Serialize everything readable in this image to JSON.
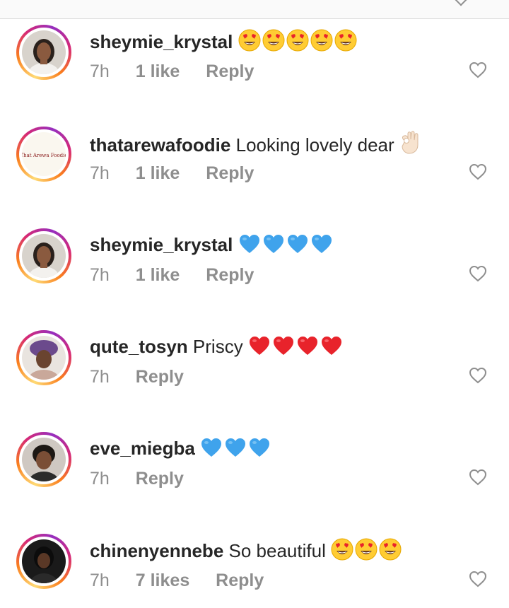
{
  "comments": [
    {
      "username": "sheymie_krystal",
      "text": "",
      "emoji": "heart-eyes",
      "emoji_count": 5,
      "time": "7h",
      "likes": "1 like",
      "reply": "Reply",
      "avatar": "woman-portrait"
    },
    {
      "username": "thatarewafoodie",
      "text": "Looking lovely dear",
      "emoji": "ok-hand",
      "emoji_count": 1,
      "time": "7h",
      "likes": "1 like",
      "reply": "Reply",
      "avatar": "foodie-logo",
      "avatar_logo_text": "That Arewa Foodie"
    },
    {
      "username": "sheymie_krystal",
      "text": "",
      "emoji": "blue-heart",
      "emoji_count": 4,
      "time": "7h",
      "likes": "1 like",
      "reply": "Reply",
      "avatar": "woman-portrait"
    },
    {
      "username": "qute_tosyn",
      "text": "Priscy",
      "emoji": "red-heart",
      "emoji_count": 4,
      "time": "7h",
      "likes": "",
      "reply": "Reply",
      "avatar": "woman-headwrap"
    },
    {
      "username": "eve_miegba",
      "text": "",
      "emoji": "blue-heart",
      "emoji_count": 3,
      "time": "7h",
      "likes": "",
      "reply": "Reply",
      "avatar": "woman-selfie"
    },
    {
      "username": "chinenyennebe",
      "text": "So beautiful",
      "emoji": "heart-eyes",
      "emoji_count": 3,
      "time": "7h",
      "likes": "7 likes",
      "reply": "Reply",
      "avatar": "woman-dark"
    }
  ],
  "colors": {
    "text": "#262626",
    "meta": "#8e8e8e",
    "ring": "#d62976"
  }
}
